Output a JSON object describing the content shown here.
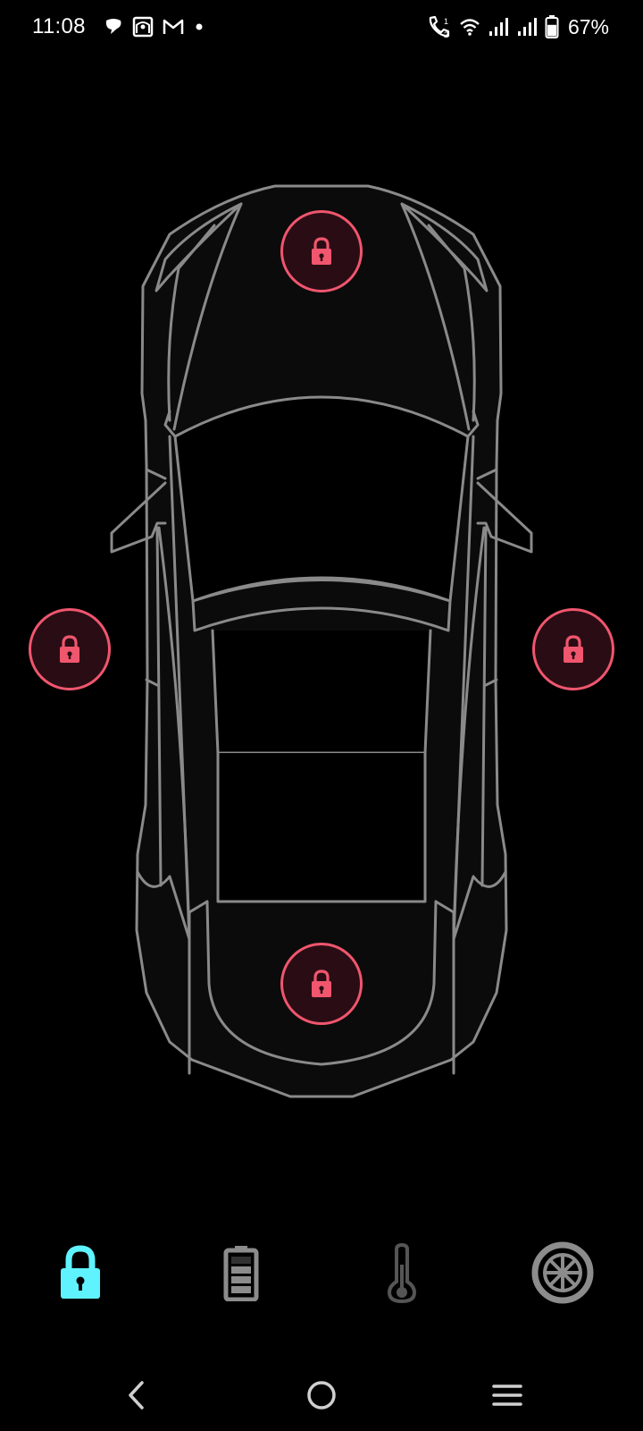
{
  "status_bar": {
    "time": "11:08",
    "left_icons": [
      "chat-bubble-icon",
      "photo-notification-icon",
      "gmail-icon",
      "more-dot-icon"
    ],
    "right_icons": [
      "wifi-calling-icon",
      "wifi-icon",
      "signal-sim1-icon",
      "signal-sim2-icon",
      "battery-icon"
    ],
    "battery_percent": "67%",
    "battery_level": 0.67
  },
  "car": {
    "view": "top-down",
    "locks": {
      "front": {
        "state": "locked",
        "icon": "lock-icon"
      },
      "left": {
        "state": "locked",
        "icon": "lock-icon"
      },
      "right": {
        "state": "locked",
        "icon": "lock-icon"
      },
      "rear": {
        "state": "locked",
        "icon": "lock-icon"
      }
    },
    "lock_color": "#f0566e",
    "lock_bg": "#2a0d14",
    "outline_color": "#8a8a8a"
  },
  "tab_bar": {
    "active_color": "#5ff3ff",
    "inactive_color": "#8c8c8c",
    "tabs": [
      {
        "id": "locks",
        "icon": "lock-icon",
        "active": true
      },
      {
        "id": "battery",
        "icon": "battery-icon",
        "active": false
      },
      {
        "id": "climate",
        "icon": "thermometer-icon",
        "active": false
      },
      {
        "id": "tires",
        "icon": "tire-icon",
        "active": false
      }
    ]
  },
  "nav_bar": {
    "buttons": [
      "back-icon",
      "home-icon",
      "menu-icon"
    ]
  }
}
